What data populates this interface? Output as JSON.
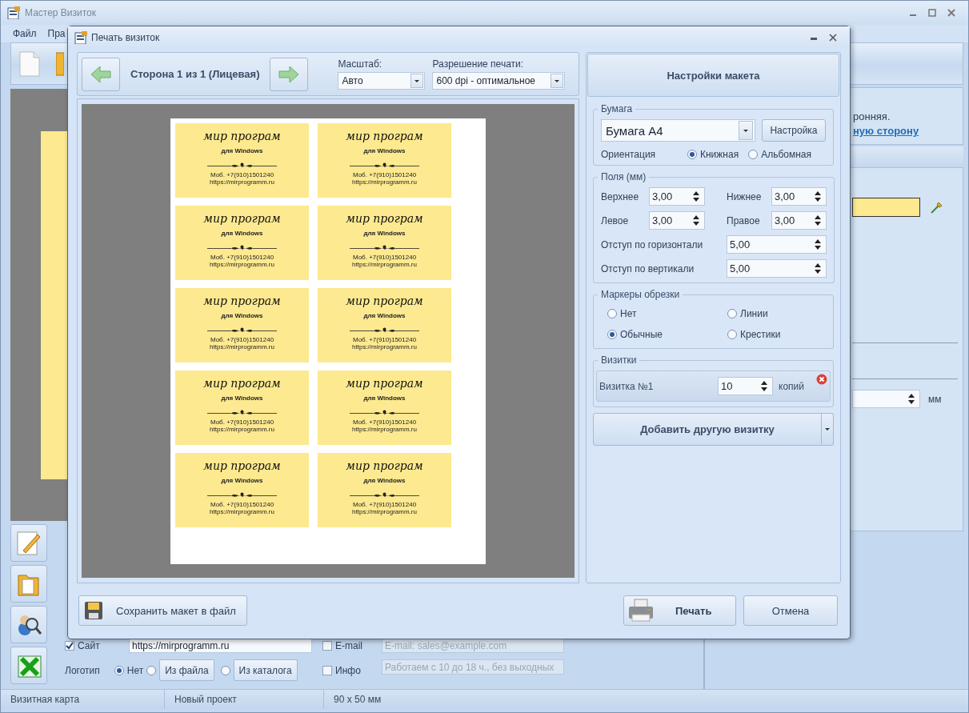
{
  "main_window": {
    "title": "Мастер Визиток",
    "menu": [
      {
        "label": "Файл"
      },
      {
        "label": "Пра"
      }
    ],
    "right_panel": {
      "text": "ронняя.",
      "link": "ную сторону",
      "unit": "мм"
    },
    "fields": [
      {
        "kind": "site",
        "label": "Сайт",
        "checked": true,
        "value": "https://mirprogramm.ru"
      },
      {
        "kind": "email",
        "label": "E-mail",
        "checked": false,
        "placeholder": "E-mail: sales@example.com"
      },
      {
        "kind": "info",
        "label": "Инфо",
        "checked": false,
        "placeholder": "Работаем с 10 до 18 ч., без выходных"
      }
    ],
    "logo": {
      "label": "Логотип",
      "options": [
        {
          "kind": "label",
          "label": "Нет",
          "selected": true
        },
        {
          "kind": "button",
          "label": "Из файла",
          "selected": false
        },
        {
          "kind": "button",
          "label": "Из каталога",
          "selected": false
        }
      ]
    },
    "status_bar": [
      "Визитная карта",
      "Новый проект",
      "90 x 50 мм"
    ]
  },
  "dialog": {
    "title": "Печать визиток",
    "side_label": "Сторона 1 из 1 (Лицевая)",
    "scale": {
      "label": "Масштаб:",
      "value": "Авто"
    },
    "resolution": {
      "label": "Разрешение печати:",
      "value": "600 dpi - оптимальное"
    },
    "cards": [
      {
        "title": "мир програм",
        "subtitle": "для Windows",
        "phone": "Моб. +7(910)1501240",
        "site": "https://mirprogramm.ru"
      },
      {
        "title": "мир програм",
        "subtitle": "для Windows",
        "phone": "Моб. +7(910)1501240",
        "site": "https://mirprogramm.ru"
      },
      {
        "title": "мир програм",
        "subtitle": "для Windows",
        "phone": "Моб. +7(910)1501240",
        "site": "https://mirprogramm.ru"
      },
      {
        "title": "мир програм",
        "subtitle": "для Windows",
        "phone": "Моб. +7(910)1501240",
        "site": "https://mirprogramm.ru"
      },
      {
        "title": "мир програм",
        "subtitle": "для Windows",
        "phone": "Моб. +7(910)1501240",
        "site": "https://mirprogramm.ru"
      },
      {
        "title": "мир програм",
        "subtitle": "для Windows",
        "phone": "Моб. +7(910)1501240",
        "site": "https://mirprogramm.ru"
      },
      {
        "title": "мир програм",
        "subtitle": "для Windows",
        "phone": "Моб. +7(910)1501240",
        "site": "https://mirprogramm.ru"
      },
      {
        "title": "мир програм",
        "subtitle": "для Windows",
        "phone": "Моб. +7(910)1501240",
        "site": "https://mirprogramm.ru"
      },
      {
        "title": "мир програм",
        "subtitle": "для Windows",
        "phone": "Моб. +7(910)1501240",
        "site": "https://mirprogramm.ru"
      },
      {
        "title": "мир програм",
        "subtitle": "для Windows",
        "phone": "Моб. +7(910)1501240",
        "site": "https://mirprogramm.ru"
      }
    ],
    "save_button": "Сохранить макет в файл",
    "settings_header": "Настройки макета",
    "paper": {
      "legend": "Бумага",
      "value": "Бумага А4",
      "button": "Настройка",
      "orientation_label": "Ориентация",
      "orientations": [
        {
          "label": "Книжная",
          "selected": true
        },
        {
          "label": "Альбомная",
          "selected": false
        }
      ]
    },
    "margins": {
      "legend": "Поля (мм)",
      "fields": [
        {
          "kind": "short",
          "label": "Верхнее",
          "value": "3,00"
        },
        {
          "kind": "short",
          "label": "Нижнее",
          "value": "3,00"
        },
        {
          "kind": "short",
          "label": "Левое",
          "value": "3,00"
        },
        {
          "kind": "short",
          "label": "Правое",
          "value": "3,00"
        },
        {
          "kind": "wide",
          "label": "Отступ по горизонтали",
          "value": "5,00"
        },
        {
          "kind": "wide",
          "label": "Отступ по вертикали",
          "value": "5,00"
        }
      ]
    },
    "crop_marks": {
      "legend": "Маркеры обрезки",
      "options": [
        {
          "label": "Нет",
          "selected": false
        },
        {
          "label": "Линии",
          "selected": false
        },
        {
          "label": "Обычные",
          "selected": true
        },
        {
          "label": "Крестики",
          "selected": false
        }
      ]
    },
    "cards_group": {
      "legend": "Визитки",
      "items": [
        {
          "name": "Визитка №1",
          "copies": "10",
          "unit": "копий"
        }
      ]
    },
    "add_button": "Добавить другую визитку",
    "print_button": "Печать",
    "cancel_button": "Отмена"
  }
}
